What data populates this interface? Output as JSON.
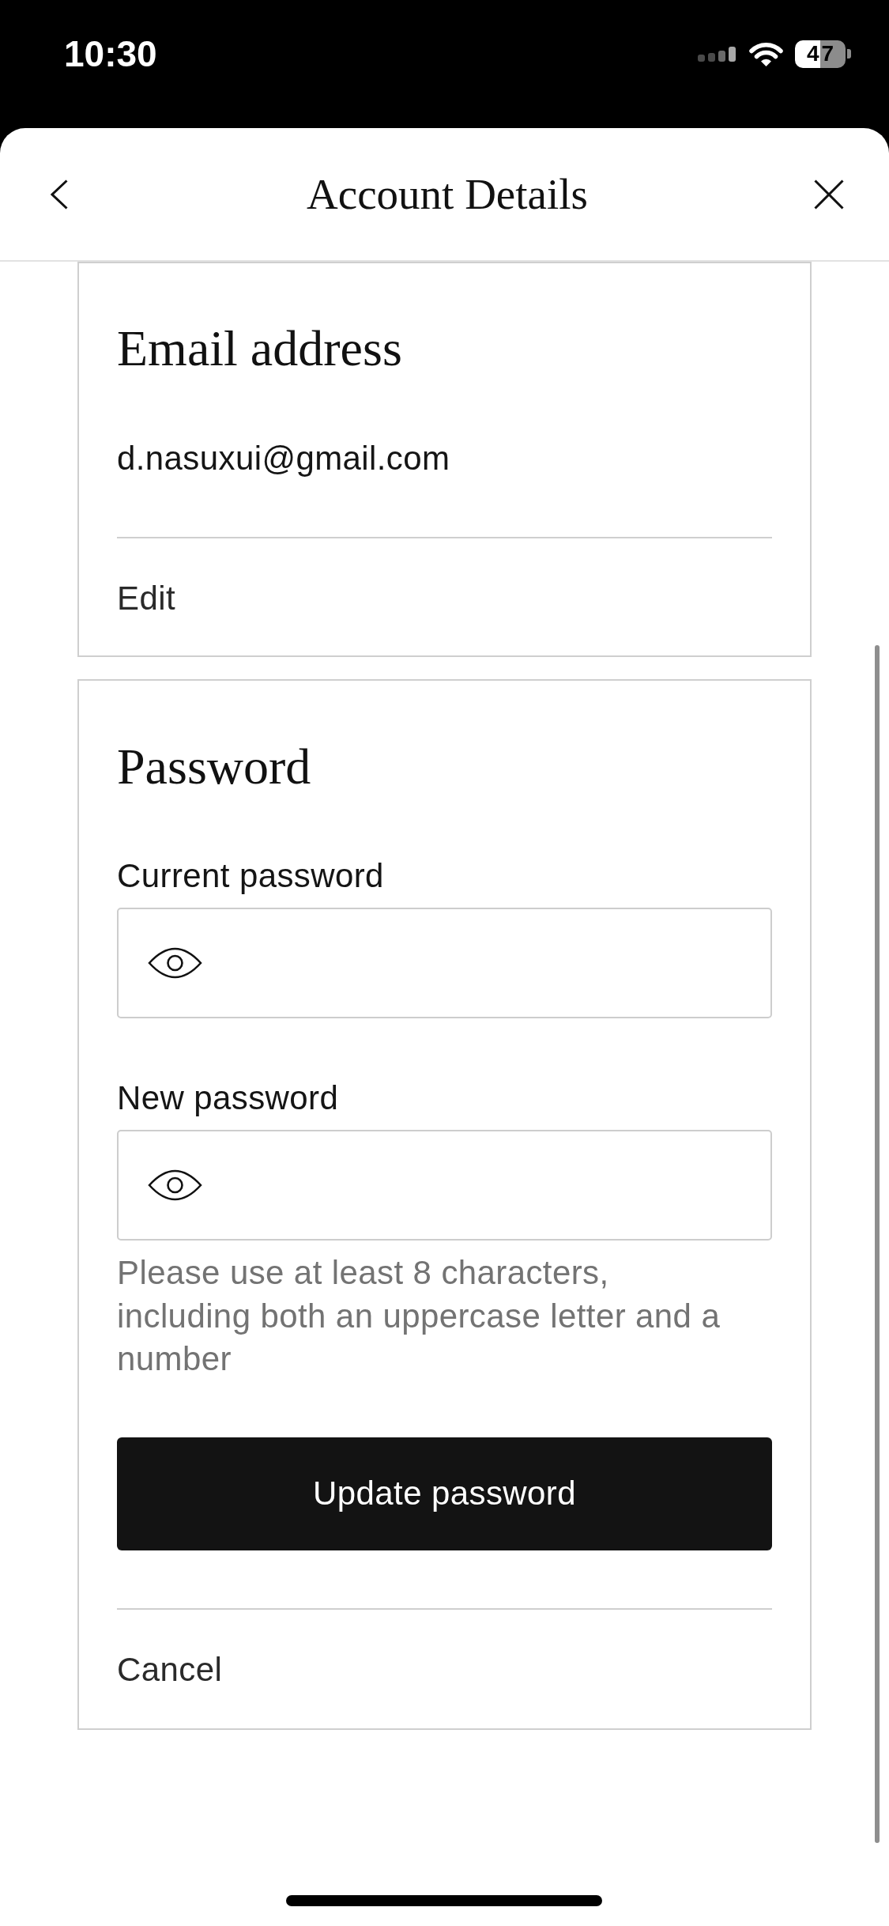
{
  "status_bar": {
    "time": "10:30",
    "battery": "47"
  },
  "header": {
    "title": "Account Details"
  },
  "email_section": {
    "title": "Email address",
    "email": "d.nasuxui@gmail.com",
    "action": "Edit"
  },
  "password_section": {
    "title": "Password",
    "fields": [
      {
        "label": "Current password"
      },
      {
        "label": "New password"
      }
    ],
    "hint": "Please use at least 8 characters, including both an uppercase letter and a number",
    "submit_button": "Update password",
    "cancel": "Cancel"
  }
}
